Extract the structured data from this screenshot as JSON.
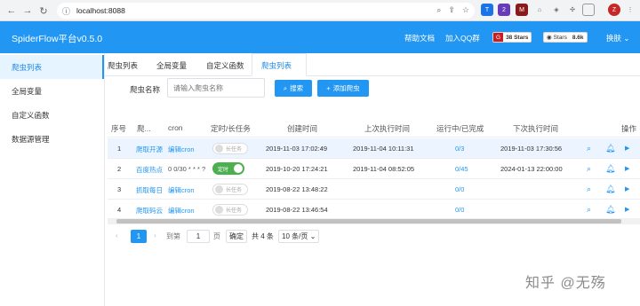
{
  "browser": {
    "url": "localhost:8088",
    "extensions": [
      "T",
      "2",
      "M",
      "Z"
    ]
  },
  "header": {
    "title": "SpiderFlow平台v0.5.0",
    "links": [
      "帮助文档",
      "加入QQ群"
    ],
    "badge1": {
      "label": "38 Stars"
    },
    "badge2": {
      "label": "Stars",
      "count": "8.6k"
    },
    "skin": "换肤"
  },
  "sidebar": {
    "items": [
      {
        "label": "爬虫列表"
      },
      {
        "label": "全局变量"
      },
      {
        "label": "自定义函数"
      },
      {
        "label": "数据源管理"
      }
    ]
  },
  "tabs": [
    "爬虫列表",
    "全局变量",
    "自定义函数",
    "爬虫列表"
  ],
  "search": {
    "label": "爬虫名称",
    "placeholder": "请输入爬虫名称",
    "search_button": "搜索",
    "add_button": "添加爬虫"
  },
  "table": {
    "headers": [
      "序号",
      "爬...",
      "cron",
      "定时/长任务",
      "创建时间",
      "上次执行时间",
      "运行中/已完成",
      "下次执行时间",
      "操作"
    ],
    "rows": [
      {
        "no": "1",
        "name": "爬取开源",
        "cron": "编辑cron",
        "toggle": "长任务",
        "on": false,
        "created": "2019-11-03 17:02:49",
        "last": "2019-11-04 10:11:31",
        "run": "0/3",
        "next": "2019-11-03 17:30:56"
      },
      {
        "no": "2",
        "name": "百度热点",
        "cron": "0 0/30 * * * ?",
        "toggle": "定时",
        "on": true,
        "created": "2019-10-20 17:24:21",
        "last": "2019-11-04 08:52:05",
        "run": "0/45",
        "next": "2024-01-13 22:00:00"
      },
      {
        "no": "3",
        "name": "抓取每日",
        "cron": "编辑cron",
        "toggle": "长任务",
        "on": false,
        "created": "2019-08-22 13:48:22",
        "last": "",
        "run": "0/0",
        "next": ""
      },
      {
        "no": "4",
        "name": "爬取码云",
        "cron": "编辑cron",
        "toggle": "长任务",
        "on": false,
        "created": "2019-08-22 13:46:54",
        "last": "",
        "run": "0/0",
        "next": ""
      }
    ]
  },
  "pager": {
    "page": "1",
    "goto": "到第",
    "page_input": "1",
    "page_unit": "页",
    "confirm": "确定",
    "total": "共 4 条",
    "size": "10 条/页"
  },
  "watermark": "知乎 @无殇"
}
